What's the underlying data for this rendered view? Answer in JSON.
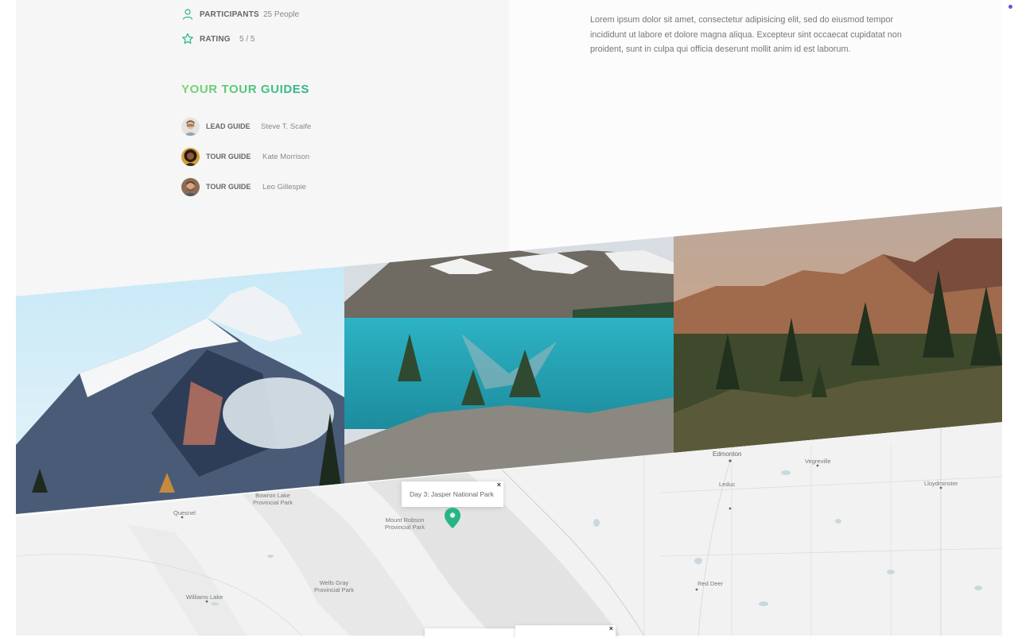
{
  "quick_facts": {
    "participants": {
      "label": "Participants",
      "value": "25 People",
      "icon": "user-icon"
    },
    "rating": {
      "label": "Rating",
      "value": "5 / 5",
      "icon": "star-icon"
    }
  },
  "guides": {
    "heading": "Your tour guides",
    "items": [
      {
        "role": "Lead guide",
        "name": "Steve T. Scaife"
      },
      {
        "role": "Tour guide",
        "name": "Kate Morrison"
      },
      {
        "role": "Tour guide",
        "name": "Leo Gillespie"
      }
    ]
  },
  "description": "Lorem ipsum dolor sit amet, consectetur adipisicing elit, sed do eiusmod tempor incididunt ut labore et dolore magna aliqua. Excepteur sint occaecat cupidatat non proident, sunt in culpa qui officia deserunt mollit anim id est laborum.",
  "pictures": [
    {
      "name": "snowy-mountain-peaks"
    },
    {
      "name": "turquoise-lake"
    },
    {
      "name": "sunset-forest-mountains"
    }
  ],
  "map": {
    "labels": {
      "edmonton": "Edmonton",
      "vegreville": "Vegreville",
      "leduc": "Leduc",
      "lloydminster": "Lloydminster",
      "bowron_lake": "Bowron Lake\nProvincial Park",
      "quesnel": "Quesnel",
      "mount_robson": "Mount Robson\nProvincial Park",
      "wells_gray": "Wells Gray\nProvincial Park",
      "williams_lake": "Williams Lake",
      "red_deer": "Red Deer"
    },
    "popup": {
      "text": "Day 3: Jasper National Park",
      "close": "×"
    },
    "popup_close_glyph": "×",
    "accent_color": "#28b487"
  },
  "colors": {
    "brand_green_light": "#7dd56f",
    "brand_green_dark": "#28b487"
  }
}
